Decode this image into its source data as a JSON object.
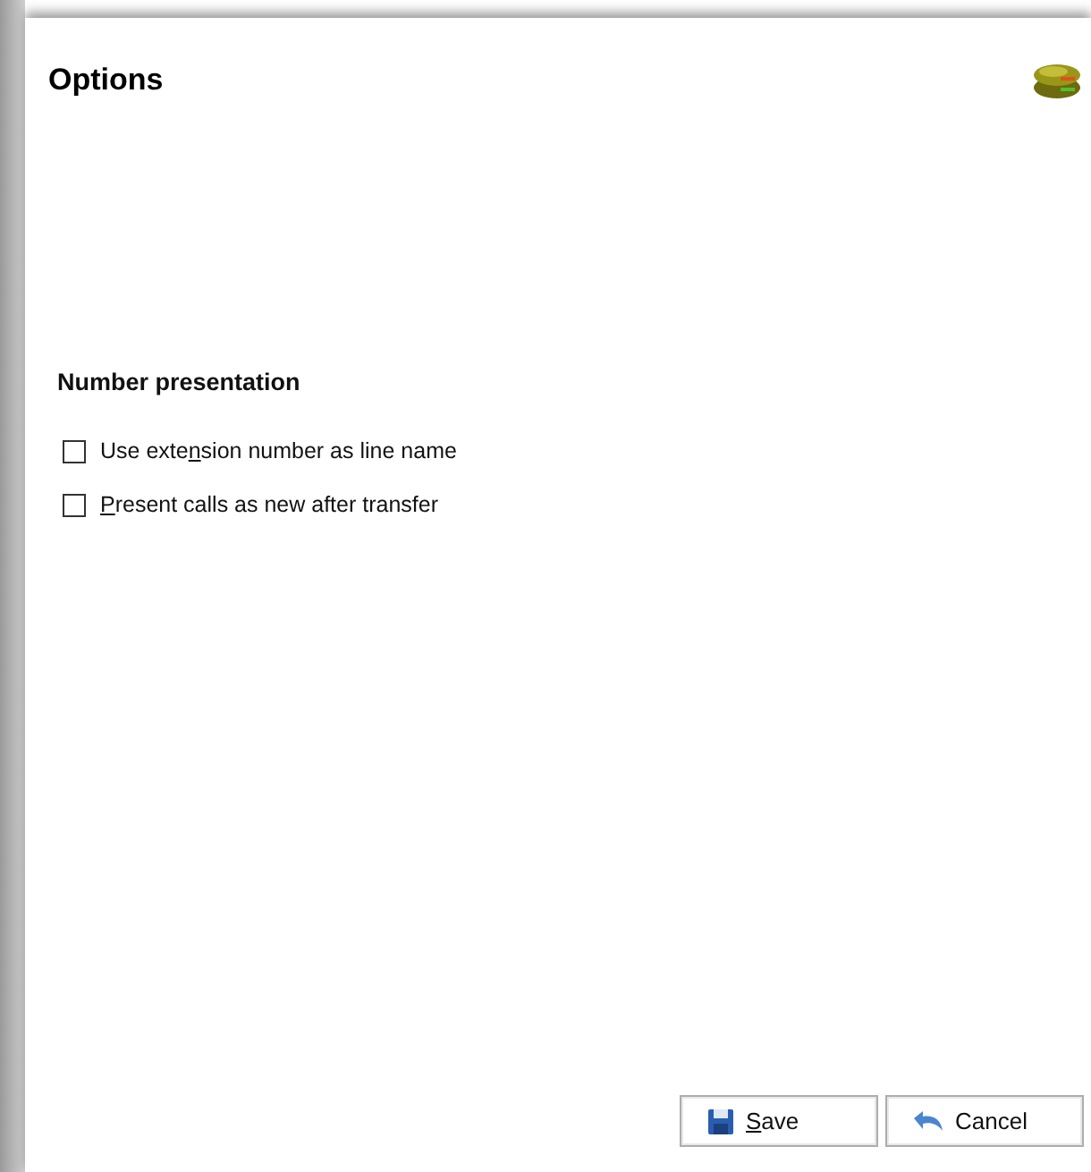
{
  "window": {
    "title": "Options"
  },
  "section": {
    "heading": "Number presentation",
    "options": [
      {
        "label": {
          "before": "Use exte",
          "access_key": "n",
          "after": "sion number as line name"
        },
        "checked": false
      },
      {
        "label": {
          "access_key": "P",
          "after": "resent calls as new after transfer"
        },
        "checked": false
      }
    ]
  },
  "buttons": [
    {
      "kind": "save",
      "label": {
        "access_key": "S",
        "after": "ave"
      }
    },
    {
      "kind": "cancel",
      "label": {
        "before": "Cancel"
      }
    }
  ]
}
